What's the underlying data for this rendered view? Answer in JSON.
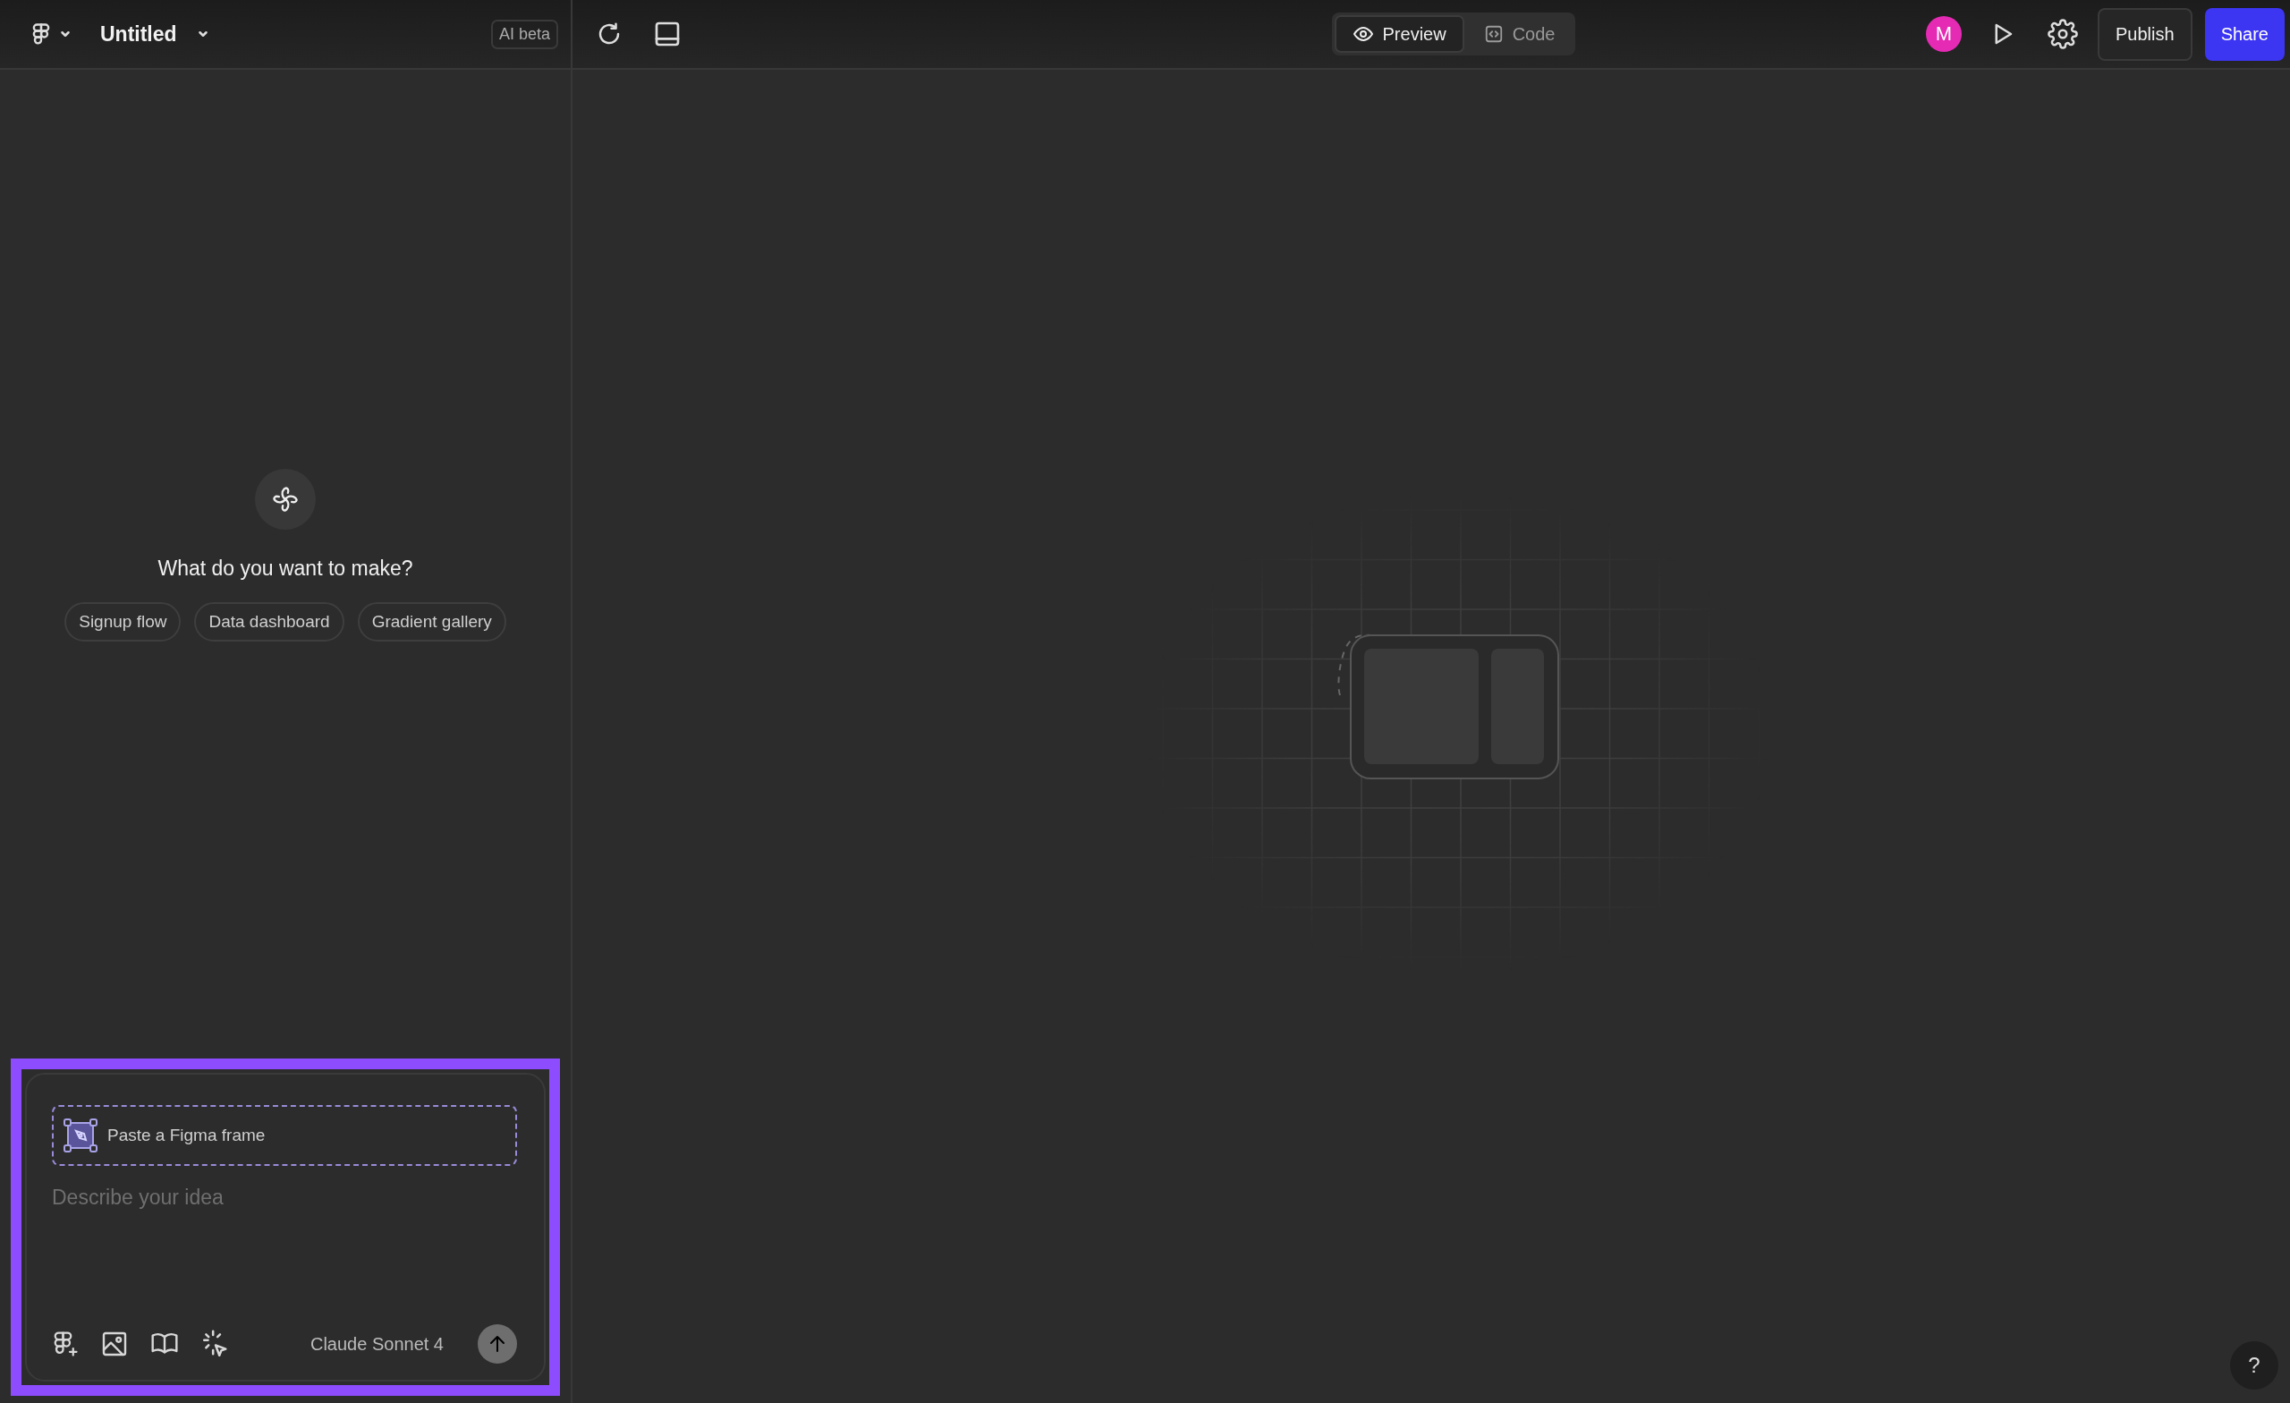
{
  "top_bar": {
    "file_name": "Untitled",
    "badge": "AI beta",
    "view_toggle": [
      {
        "label": "Preview",
        "selected": true
      },
      {
        "label": "Code",
        "selected": false
      }
    ],
    "avatar_initial": "M",
    "publish_button": "Publish",
    "share_button": "Share"
  },
  "chat_panel": {
    "heading": "What do you want to make?",
    "suggestions": [
      "Signup flow",
      "Data dashboard",
      "Gradient gallery"
    ],
    "prompt": {
      "frame_drop": "Paste a Figma frame",
      "placeholder": "Describe your idea",
      "model": "Claude Sonnet 4"
    }
  },
  "help_button": "?"
}
